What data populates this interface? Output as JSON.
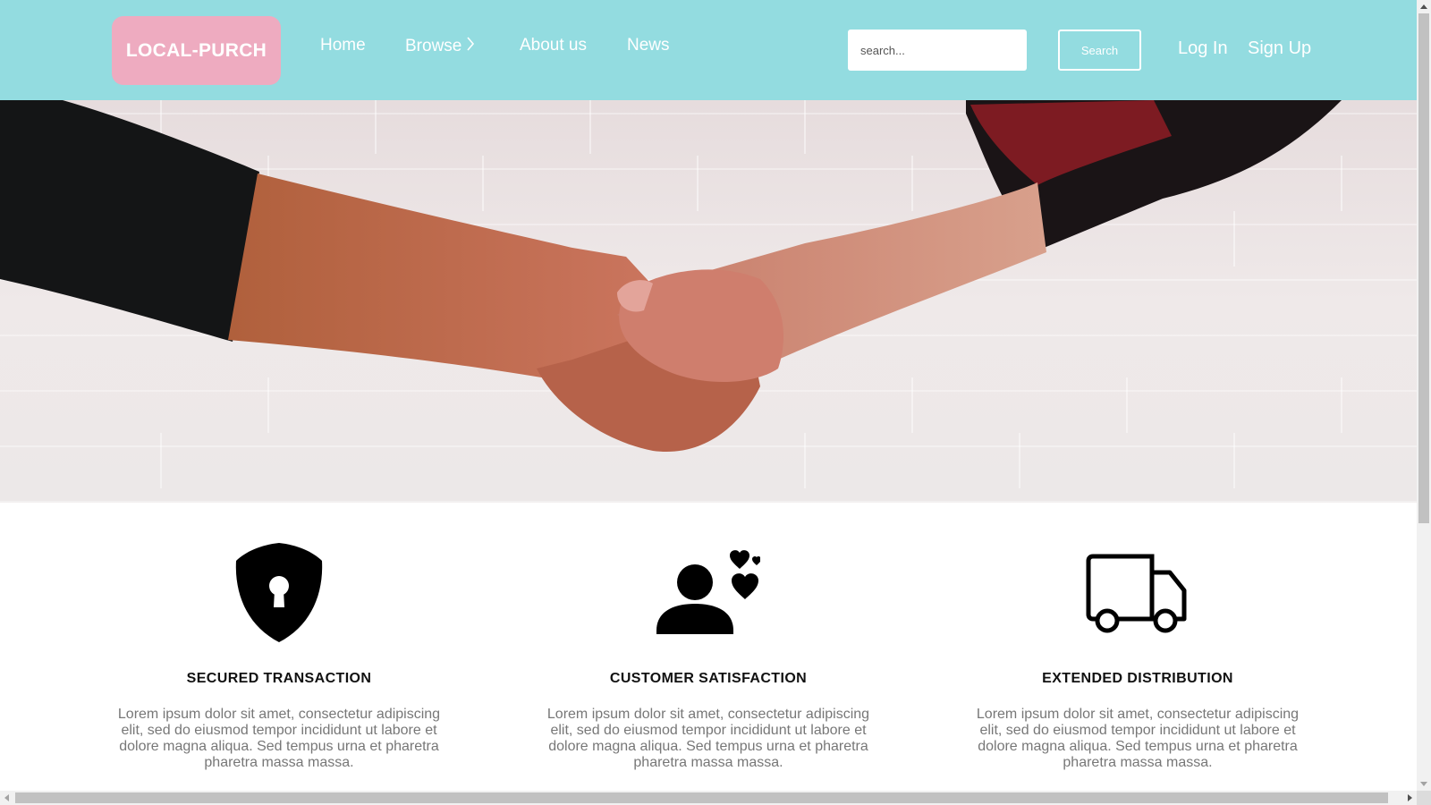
{
  "header": {
    "logo_text": "LOCAL-PURCH",
    "nav": [
      {
        "label": "Home"
      },
      {
        "label": "Browse",
        "icon": "chevron-right-icon"
      },
      {
        "label": "About us"
      },
      {
        "label": "News"
      }
    ],
    "search": {
      "placeholder": "search...",
      "value": "",
      "button_label": "Search"
    },
    "login_label": "Log In",
    "signup_label": "Sign Up"
  },
  "hero": {
    "image": "handshake-photo"
  },
  "features": [
    {
      "icon": "shield-keyhole-icon",
      "title": "SECURED TRANSACTION",
      "text": "Lorem ipsum dolor sit amet, consectetur adipiscing elit, sed do eiusmod tempor incididunt ut labore et dolore magna aliqua. Sed tempus urna et pharetra pharetra massa massa."
    },
    {
      "icon": "user-hearts-icon",
      "title": "CUSTOMER SATISFACTION",
      "text": "Lorem ipsum dolor sit amet, consectetur adipiscing elit, sed do eiusmod tempor incididunt ut labore et dolore magna aliqua. Sed tempus urna et pharetra pharetra massa massa."
    },
    {
      "icon": "truck-icon",
      "title": "EXTENDED DISTRIBUTION",
      "text": "Lorem ipsum dolor sit amet, consectetur adipiscing elit, sed do eiusmod tempor incididunt ut labore et dolore magna aliqua. Sed tempus urna et pharetra pharetra massa massa."
    }
  ],
  "colors": {
    "header_bg": "#93dce0",
    "logo_bg": "#eeabc0",
    "text_muted": "#777777"
  }
}
